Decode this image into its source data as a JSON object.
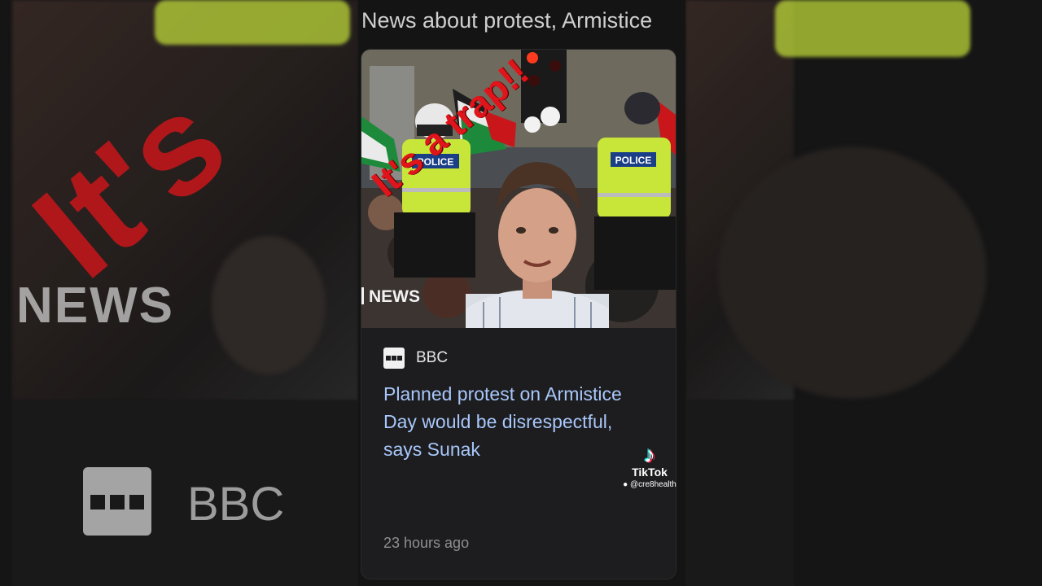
{
  "search_header": {
    "title": "News about protest, Armistice"
  },
  "article": {
    "source": "BBC",
    "headline": "Planned protest on Armistice Day would be disrespectful, says Sunak",
    "time": "23 hours ago",
    "thumbnail": {
      "watermark": "NEWS",
      "overlay_text": "It's a trap!!",
      "police_label": "POLICE"
    }
  },
  "background": {
    "overlay_text": "It's",
    "watermark": "NEWS",
    "source": "BBC"
  },
  "tiktok": {
    "label": "TikTok",
    "user": "@cre8health",
    "icon": "tiktok-logo-icon"
  },
  "colors": {
    "headline": "#a8c7fa",
    "overlay": "#e0141b",
    "card": "#1d1d1f"
  }
}
